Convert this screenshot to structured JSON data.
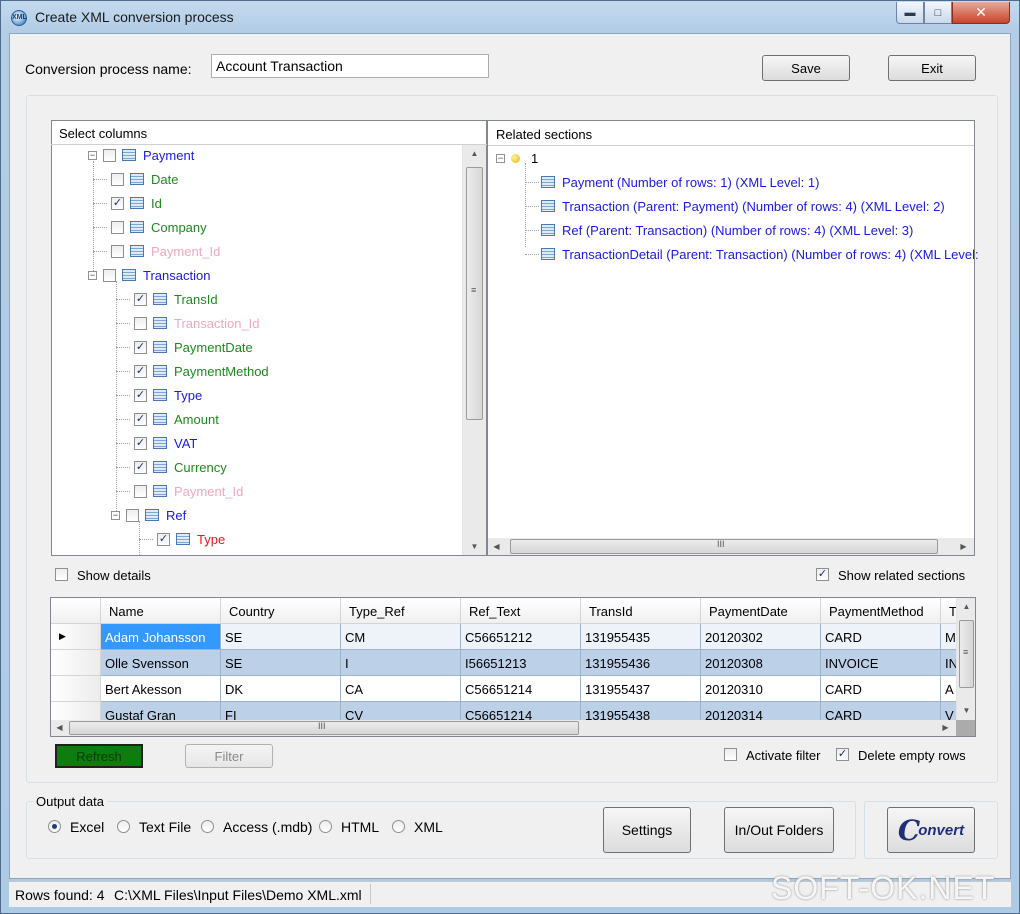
{
  "window": {
    "title": "Create XML conversion process"
  },
  "header": {
    "name_label": "Conversion process name:",
    "name_value": "Account Transaction",
    "save_label": "Save",
    "exit_label": "Exit"
  },
  "select_columns": {
    "title": "Select columns",
    "nodes": [
      {
        "label": "Payment",
        "color": "#1a1adb",
        "checked": false,
        "expander": "minus"
      },
      {
        "label": "Date",
        "color": "#1d8a1d",
        "checked": false
      },
      {
        "label": "Id",
        "color": "#1d8a1d",
        "checked": true
      },
      {
        "label": "Company",
        "color": "#1d8a1d",
        "checked": false
      },
      {
        "label": "Payment_Id",
        "color": "#f2a7bd",
        "checked": false
      },
      {
        "label": "Transaction",
        "color": "#1a1adb",
        "checked": false,
        "expander": "minus"
      },
      {
        "label": "TransId",
        "color": "#1d8a1d",
        "checked": true
      },
      {
        "label": "Transaction_Id",
        "color": "#f2a7bd",
        "checked": false
      },
      {
        "label": "PaymentDate",
        "color": "#1d8a1d",
        "checked": true
      },
      {
        "label": "PaymentMethod",
        "color": "#1d8a1d",
        "checked": true
      },
      {
        "label": "Type",
        "color": "#1a1adb",
        "checked": true
      },
      {
        "label": "Amount",
        "color": "#1d8a1d",
        "checked": true
      },
      {
        "label": "VAT",
        "color": "#1a1adb",
        "checked": true
      },
      {
        "label": "Currency",
        "color": "#1d8a1d",
        "checked": true
      },
      {
        "label": "Payment_Id",
        "color": "#f2a7bd",
        "checked": false
      },
      {
        "label": "Ref",
        "color": "#1a1adb",
        "checked": false,
        "expander": "minus"
      },
      {
        "label": "Type",
        "color": "#e01b1b",
        "checked": true
      }
    ]
  },
  "related_sections": {
    "title": "Related sections",
    "root_label": "1",
    "items": [
      "Payment (Number of rows: 1) (XML Level: 1)",
      "Transaction (Parent: Payment) (Number of rows: 4) (XML Level: 2)",
      "Ref (Parent: Transaction) (Number of rows: 4) (XML Level: 3)",
      "TransactionDetail (Parent: Transaction) (Number of rows: 4) (XML Level:"
    ]
  },
  "options": {
    "show_details": "Show details",
    "show_related": "Show related sections",
    "activate_filter": "Activate filter",
    "delete_empty": "Delete empty rows"
  },
  "grid": {
    "columns": [
      "Name",
      "Country",
      "Type_Ref",
      "Ref_Text",
      "TransId",
      "PaymentDate",
      "PaymentMethod",
      "T"
    ],
    "rows": [
      [
        "Adam Johansson",
        "SE",
        "CM",
        "C56651212",
        "131955435",
        "20120302",
        "CARD",
        "M"
      ],
      [
        "Olle Svensson",
        "SE",
        "I",
        "I56651213",
        "131955436",
        "20120308",
        "INVOICE",
        "IN"
      ],
      [
        "Bert Akesson",
        "DK",
        "CA",
        "C56651214",
        "131955437",
        "20120310",
        "CARD",
        "A"
      ],
      [
        "Gustaf Gran",
        "FI",
        "CV",
        "C56651214",
        "131955438",
        "20120314",
        "CARD",
        "V"
      ]
    ]
  },
  "grid_buttons": {
    "refresh": "Refresh",
    "filter": "Filter"
  },
  "output": {
    "title": "Output data",
    "formats": [
      "Excel",
      "Text File",
      "Access (.mdb)",
      "HTML",
      "XML"
    ],
    "selected": "Excel"
  },
  "bottom_buttons": {
    "settings": "Settings",
    "folders": "In/Out Folders",
    "convert": "onvert"
  },
  "status": {
    "rows_found": "Rows found: 4",
    "path": "C:\\XML Files\\Input Files\\Demo XML.xml"
  },
  "watermark": "SOFT-OK.NET",
  "colors": {
    "refresh_green": "#0d7d0d",
    "selection_blue": "#3399ff",
    "row_band": "#bcd0e8"
  }
}
